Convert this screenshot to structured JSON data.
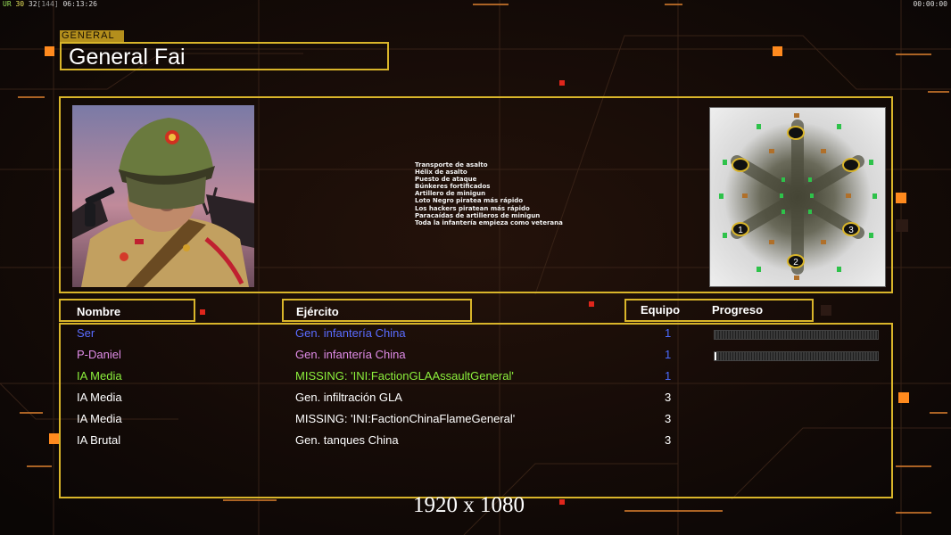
{
  "hud": {
    "left_segments": [
      {
        "text": "UR",
        "color": "g"
      },
      {
        "text": " 30 ",
        "color": "y"
      },
      {
        "text": "32",
        "color": "w"
      },
      {
        "text": "[144]",
        "color": "gr"
      },
      {
        "text": " 06:13:26",
        "color": "w"
      }
    ],
    "right_time": "00:00:00"
  },
  "general": {
    "tag": "GENERAL",
    "name": "General Fai",
    "features": [
      "Transporte de asalto",
      "Hélix de asalto",
      "Puesto de ataque",
      "Búnkeres fortificados",
      "Artillero de minigun",
      "Loto Negro piratea más rápido",
      "Los hackers piratean más rápido",
      "Paracaídas de artilleros de minigun",
      "Toda la infantería empieza como veterana"
    ]
  },
  "map": {
    "markers": [
      "1",
      "2",
      "3"
    ]
  },
  "headers": {
    "name": "Nombre",
    "army": "Ejército",
    "team": "Equipo",
    "progress": "Progreso"
  },
  "players": [
    {
      "name": "Ser",
      "army": "Gen. infantería China",
      "team": "1",
      "color": "#5a6cff",
      "progress": 0
    },
    {
      "name": "P-Daniel",
      "army": "Gen. infantería China",
      "team": "1",
      "color": "#e08ce8",
      "progress": 0.01
    },
    {
      "name": "IA Media",
      "army": "MISSING: 'INI:FactionGLAAssaultGeneral'",
      "team": "1",
      "color": "#8cf03c",
      "progress": null
    },
    {
      "name": "IA Media",
      "army": "Gen. infiltración GLA",
      "team": "3",
      "color": "#ffffff",
      "progress": null
    },
    {
      "name": "IA Media",
      "army": "MISSING: 'INI:FactionChinaFlameGeneral'",
      "team": "3",
      "color": "#ffffff",
      "progress": null
    },
    {
      "name": "IA Brutal",
      "army": "Gen. tanques China",
      "team": "3",
      "color": "#ffffff",
      "progress": null
    }
  ],
  "team_color_blue": "#4a6bff",
  "accent": "#d9b52a",
  "resolution": "1920 x 1080"
}
